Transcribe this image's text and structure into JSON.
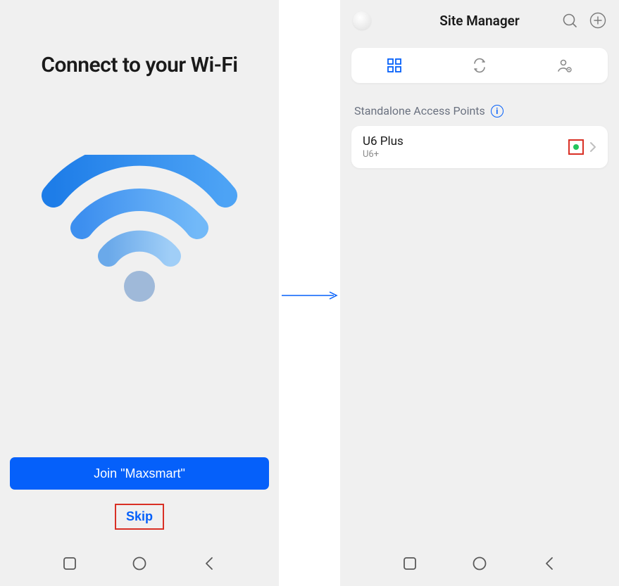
{
  "left": {
    "title": "Connect to your Wi-Fi",
    "join_label": "Join \"Maxsmart\"",
    "skip_label": "Skip"
  },
  "right": {
    "header_title": "Site Manager",
    "section_label": "Standalone Access Points",
    "device": {
      "name": "U6 Plus",
      "sub": "U6+",
      "status": "online"
    }
  },
  "colors": {
    "primary": "#0560fa",
    "highlight": "#d93025",
    "success": "#22c55e"
  }
}
